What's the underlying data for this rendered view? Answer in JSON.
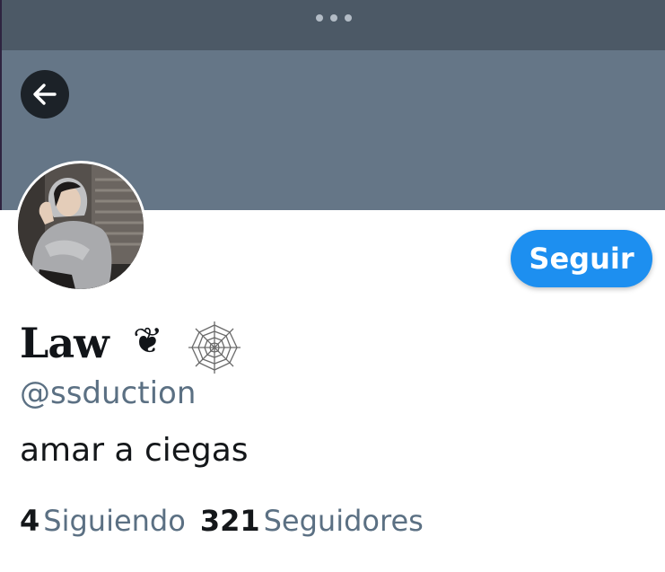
{
  "profile": {
    "display_name": "Law",
    "name_emoji": "❦",
    "name_icon": "spider-web-icon",
    "handle": "@ssduction",
    "bio": "amar a ciegas",
    "following_count": "4",
    "following_label": "Siguiendo",
    "followers_count": "321",
    "followers_label": "Seguidores",
    "avatar": "profile-photo"
  },
  "actions": {
    "follow_label": "Seguir",
    "back_icon": "arrow-left-icon",
    "more_icon": "more-dots-icon"
  },
  "colors": {
    "banner": "#657687",
    "topbar": "#4c5966",
    "accent": "#1d8ff0",
    "secondary_text": "#5b7083"
  }
}
